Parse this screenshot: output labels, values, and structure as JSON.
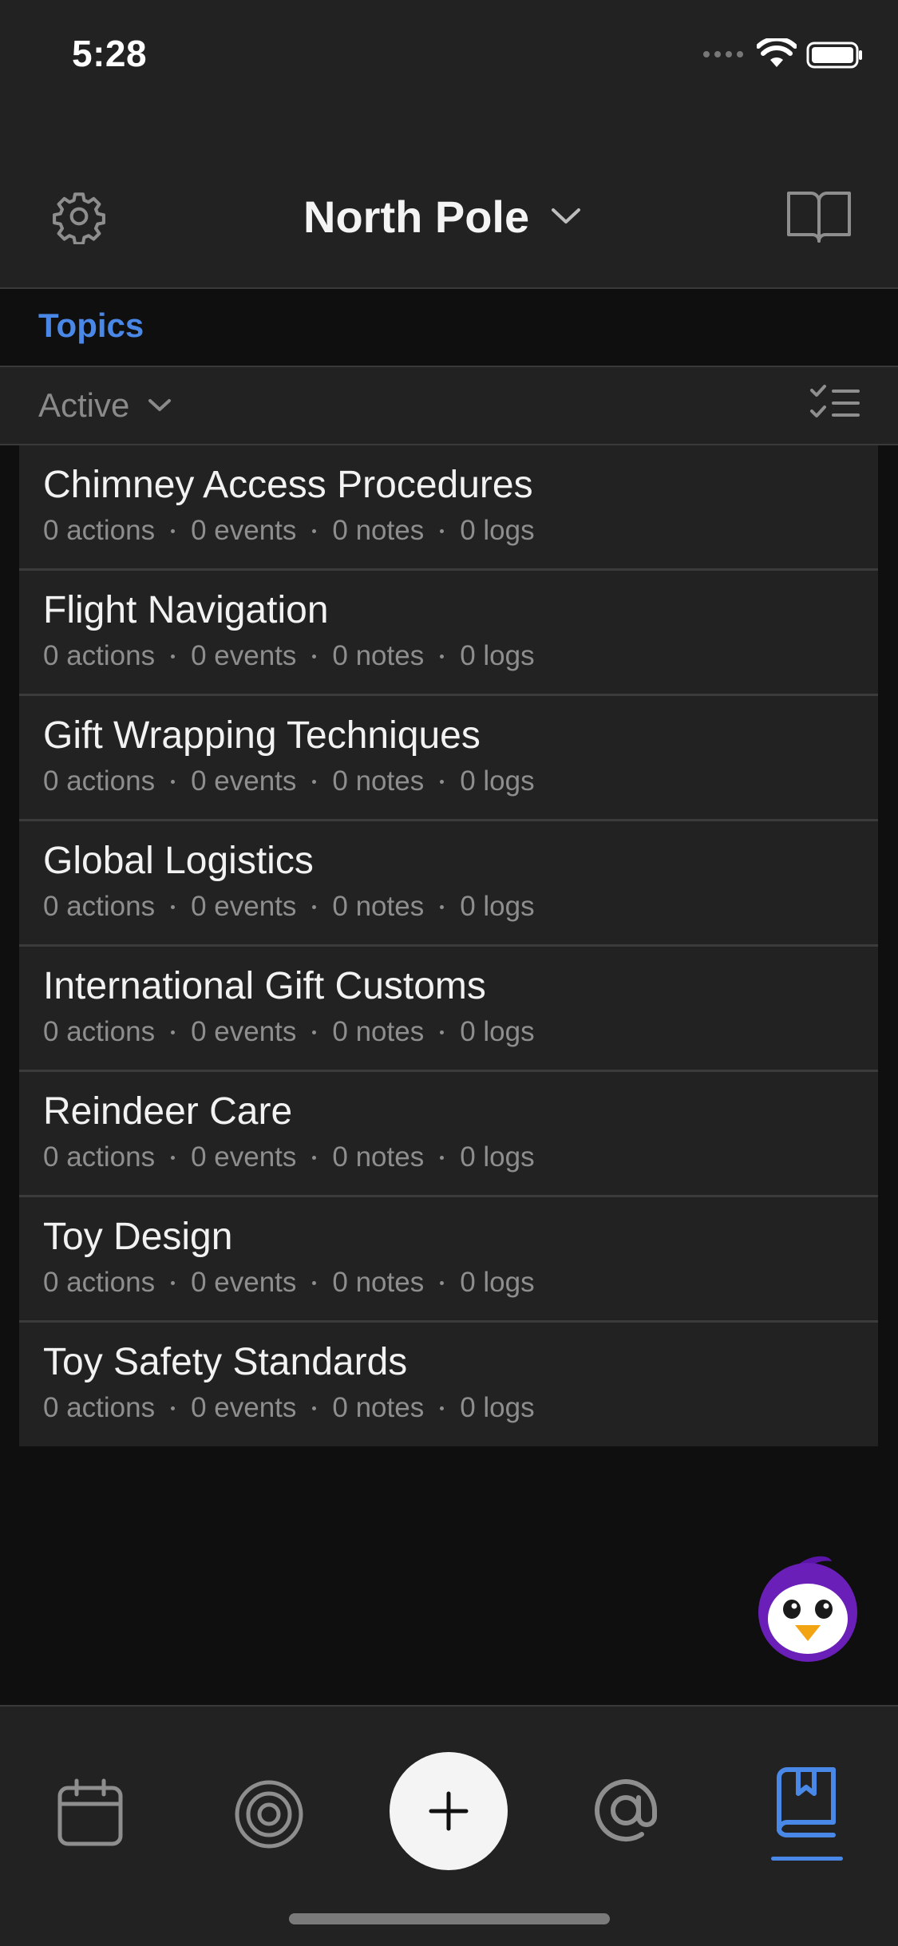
{
  "status_bar": {
    "time": "5:28"
  },
  "header": {
    "title": "North Pole"
  },
  "section": {
    "label": "Topics"
  },
  "filter": {
    "label": "Active"
  },
  "topics": [
    {
      "title": "Chimney Access Procedures",
      "actions": "0 actions",
      "events": "0 events",
      "notes": "0 notes",
      "logs": "0 logs"
    },
    {
      "title": "Flight Navigation",
      "actions": "0 actions",
      "events": "0 events",
      "notes": "0 notes",
      "logs": "0 logs"
    },
    {
      "title": "Gift Wrapping Techniques",
      "actions": "0 actions",
      "events": "0 events",
      "notes": "0 notes",
      "logs": "0 logs"
    },
    {
      "title": "Global Logistics",
      "actions": "0 actions",
      "events": "0 events",
      "notes": "0 notes",
      "logs": "0 logs"
    },
    {
      "title": "International Gift Customs",
      "actions": "0 actions",
      "events": "0 events",
      "notes": "0 notes",
      "logs": "0 logs"
    },
    {
      "title": "Reindeer Care",
      "actions": "0 actions",
      "events": "0 events",
      "notes": "0 notes",
      "logs": "0 logs"
    },
    {
      "title": "Toy Design",
      "actions": "0 actions",
      "events": "0 events",
      "notes": "0 notes",
      "logs": "0 logs"
    },
    {
      "title": "Toy Safety Standards",
      "actions": "0 actions",
      "events": "0 events",
      "notes": "0 notes",
      "logs": "0 logs"
    }
  ],
  "bottom_nav": [
    {
      "icon": "calendar-icon",
      "active": false
    },
    {
      "icon": "target-icon",
      "active": false
    },
    {
      "icon": "plus-icon",
      "active": false
    },
    {
      "icon": "at-sign-icon",
      "active": false
    },
    {
      "icon": "bookmark-book-icon",
      "active": true
    }
  ],
  "colors": {
    "accent": "#4a88e8",
    "background": "#0f0f0f",
    "surface": "#222222",
    "muted_text": "#8e8e8e",
    "mascot_purple": "#6a1fb8"
  }
}
